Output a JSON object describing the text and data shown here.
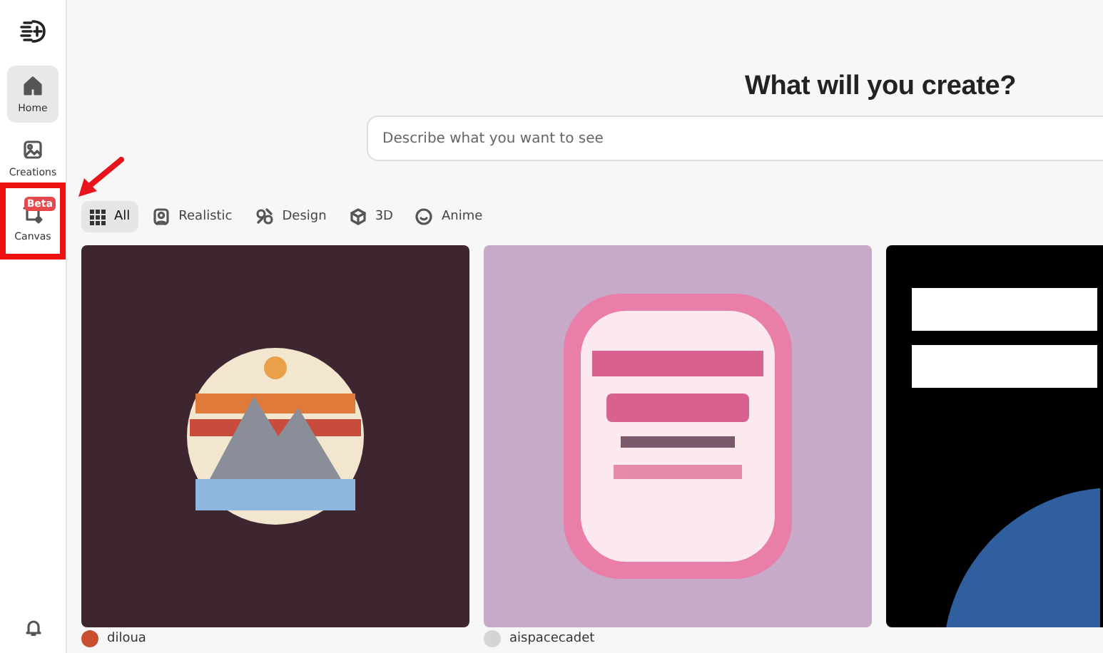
{
  "sidebar": {
    "items": [
      {
        "label": "Home",
        "selected": true,
        "highlighted": false
      },
      {
        "label": "Creations",
        "selected": false,
        "highlighted": false
      },
      {
        "label": "Canvas",
        "selected": false,
        "highlighted": true,
        "badge": "Beta"
      }
    ]
  },
  "heading": "What will you create?",
  "search": {
    "placeholder": "Describe what you want to see"
  },
  "filters": [
    {
      "label": "All",
      "selected": true
    },
    {
      "label": "Realistic",
      "selected": false
    },
    {
      "label": "Design",
      "selected": false
    },
    {
      "label": "3D",
      "selected": false
    },
    {
      "label": "Anime",
      "selected": false
    }
  ],
  "gallery": [
    {
      "kind": "emblem",
      "author": "diloua",
      "color": "#c8502e"
    },
    {
      "kind": "invitation",
      "author": "aispacecadet",
      "color": "#d4d4d4"
    },
    {
      "kind": "poster"
    }
  ]
}
